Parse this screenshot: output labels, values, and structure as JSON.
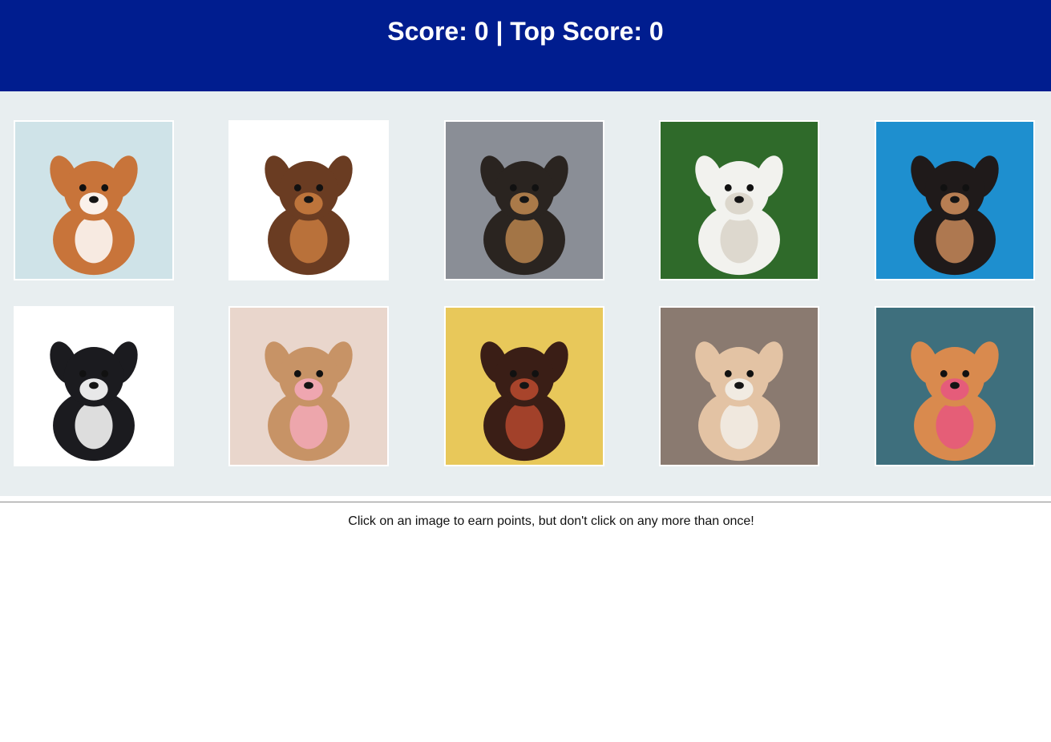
{
  "header": {
    "score_label": "Score: 0 | Top Score: 0",
    "background": "#001d8f"
  },
  "gallery": {
    "background": "#e8eef0",
    "cards": [
      {
        "name": "puppy-card-corgi-mix-on-deck",
        "bg": "#cfe3e8",
        "fur": "#c8743a",
        "accent": "#ffffff"
      },
      {
        "name": "puppy-card-litter-group",
        "bg": "#ffffff",
        "fur": "#6a3c22",
        "accent": "#c77a3e"
      },
      {
        "name": "puppy-card-two-yorkies",
        "bg": "#8a8e96",
        "fur": "#2a2420",
        "accent": "#b8844e"
      },
      {
        "name": "puppy-card-white-lab-on-grass",
        "bg": "#2f6a2a",
        "fur": "#f2f2ee",
        "accent": "#d9d4c8"
      },
      {
        "name": "puppy-card-corgi-on-blue",
        "bg": "#1e8fcf",
        "fur": "#1f1a1a",
        "accent": "#c88a5a"
      },
      {
        "name": "puppy-card-border-collie",
        "bg": "#ffffff",
        "fur": "#1b1b1f",
        "accent": "#ffffff"
      },
      {
        "name": "puppy-card-poodle-with-rose",
        "bg": "#e9d6cc",
        "fur": "#c79366",
        "accent": "#f3a9b8"
      },
      {
        "name": "puppy-card-dachshund",
        "bg": "#e8c85a",
        "fur": "#3a1e16",
        "accent": "#b5482e"
      },
      {
        "name": "puppy-card-french-bulldog",
        "bg": "#8a7a70",
        "fur": "#e3c3a4",
        "accent": "#f2efe9"
      },
      {
        "name": "puppy-card-golden-puppy",
        "bg": "#3e6f7d",
        "fur": "#d98a4e",
        "accent": "#e6567f"
      }
    ]
  },
  "footer": {
    "instructions": "Click on an image to earn points, but don't click on any more than once!"
  }
}
